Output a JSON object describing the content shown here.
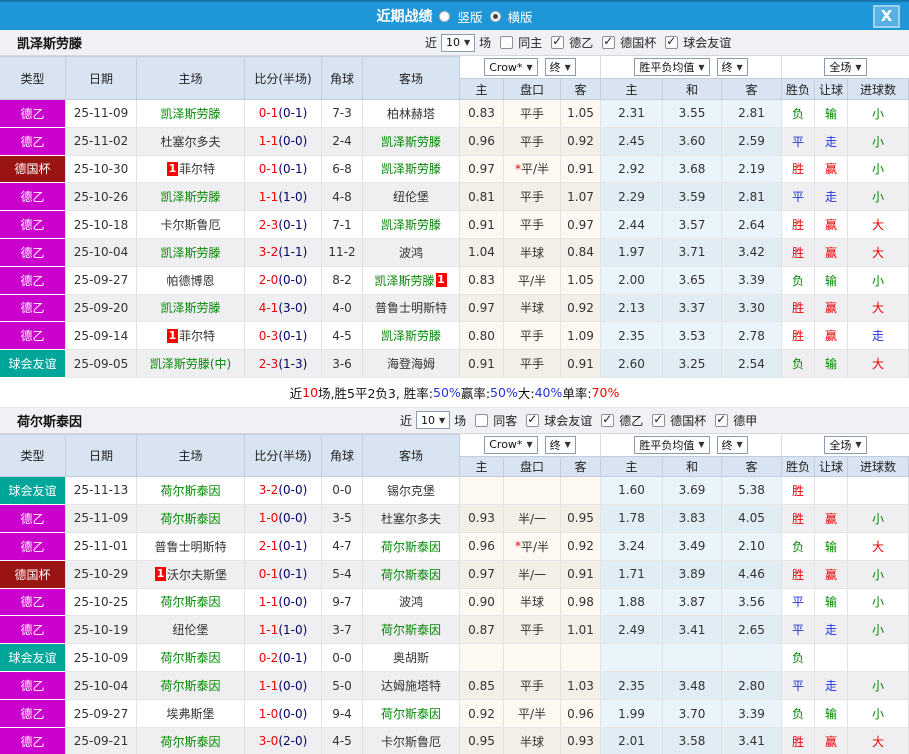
{
  "titlebar": {
    "title": "近期战绩",
    "vertical_label": "竖版",
    "horizontal_label": "横版",
    "close_label": "X"
  },
  "colors": {
    "type_badges": {
      "德乙": "#cc00cc",
      "德国杯": "#9a1414",
      "球会友谊": "#00a69a"
    },
    "results": {
      "胜": "#e60000",
      "赢": "#e60000",
      "大": "#e60000",
      "平": "#2233dd",
      "走": "#2233dd",
      "负": "#008800",
      "输": "#008800",
      "小": "#008800"
    },
    "accent_blue": "#1e96d7"
  },
  "columns": {
    "type": "类型",
    "date": "日期",
    "home": "主场",
    "score": "比分(半场)",
    "corner": "角球",
    "away": "客场",
    "crow_select": "Crow*",
    "crow_final": "终",
    "crow_sub": [
      "主",
      "盘口",
      "客"
    ],
    "mean_select": "胜平负均值",
    "mean_final": "终",
    "mean_sub": [
      "主",
      "和",
      "客"
    ],
    "full_select": "全场",
    "full_sub": [
      "胜负",
      "让球",
      "进球数"
    ]
  },
  "team1": {
    "name": "凯泽斯劳滕",
    "filter": {
      "prefix": "近",
      "count": "10",
      "suffix": "场",
      "same_label": "同主",
      "leagues": [
        {
          "label": "德乙"
        },
        {
          "label": "德国杯"
        },
        {
          "label": "球会友谊"
        }
      ]
    },
    "rows": [
      {
        "type": "德乙",
        "date": "25-11-09",
        "home": {
          "n": "凯泽斯劳滕",
          "g": true
        },
        "ft": "0-1",
        "ht": "(0-1)",
        "corner": "7-3",
        "away": {
          "n": "柏林赫塔"
        },
        "crow": [
          "0.83",
          "平手",
          "1.05"
        ],
        "mean": [
          "2.31",
          "3.55",
          "2.81"
        ],
        "res": [
          "负",
          "输",
          "小"
        ]
      },
      {
        "type": "德乙",
        "date": "25-11-02",
        "home": {
          "n": "杜塞尔多夫"
        },
        "ft": "1-1",
        "ht": "(0-0)",
        "corner": "2-4",
        "away": {
          "n": "凯泽斯劳滕",
          "g": true
        },
        "crow": [
          "0.96",
          "平手",
          "0.92"
        ],
        "mean": [
          "2.45",
          "3.60",
          "2.59"
        ],
        "res": [
          "平",
          "走",
          "小"
        ]
      },
      {
        "type": "德国杯",
        "date": "25-10-30",
        "home": {
          "n": "菲尔特",
          "b": "1"
        },
        "ft": "0-1",
        "ht": "(0-1)",
        "corner": "6-8",
        "away": {
          "n": "凯泽斯劳滕",
          "g": true
        },
        "crow": [
          "0.97",
          "*平/半",
          "0.91"
        ],
        "mean": [
          "2.92",
          "3.68",
          "2.19"
        ],
        "res": [
          "胜",
          "赢",
          "小"
        ]
      },
      {
        "type": "德乙",
        "date": "25-10-26",
        "home": {
          "n": "凯泽斯劳滕",
          "g": true
        },
        "ft": "1-1",
        "ht": "(1-0)",
        "corner": "4-8",
        "away": {
          "n": "纽伦堡"
        },
        "crow": [
          "0.81",
          "平手",
          "1.07"
        ],
        "mean": [
          "2.29",
          "3.59",
          "2.81"
        ],
        "res": [
          "平",
          "走",
          "小"
        ]
      },
      {
        "type": "德乙",
        "date": "25-10-18",
        "home": {
          "n": "卡尔斯鲁厄"
        },
        "ft": "2-3",
        "ht": "(0-1)",
        "corner": "7-1",
        "away": {
          "n": "凯泽斯劳滕",
          "g": true
        },
        "crow": [
          "0.91",
          "平手",
          "0.97"
        ],
        "mean": [
          "2.44",
          "3.57",
          "2.64"
        ],
        "res": [
          "胜",
          "赢",
          "大"
        ]
      },
      {
        "type": "德乙",
        "date": "25-10-04",
        "home": {
          "n": "凯泽斯劳滕",
          "g": true
        },
        "ft": "3-2",
        "ht": "(1-1)",
        "corner": "11-2",
        "away": {
          "n": "波鸿"
        },
        "crow": [
          "1.04",
          "半球",
          "0.84"
        ],
        "mean": [
          "1.97",
          "3.71",
          "3.42"
        ],
        "res": [
          "胜",
          "赢",
          "大"
        ]
      },
      {
        "type": "德乙",
        "date": "25-09-27",
        "home": {
          "n": "帕德博恩"
        },
        "ft": "2-0",
        "ht": "(0-0)",
        "corner": "8-2",
        "away": {
          "n": "凯泽斯劳滕",
          "g": true,
          "b": "1"
        },
        "crow": [
          "0.83",
          "平/半",
          "1.05"
        ],
        "mean": [
          "2.00",
          "3.65",
          "3.39"
        ],
        "res": [
          "负",
          "输",
          "小"
        ]
      },
      {
        "type": "德乙",
        "date": "25-09-20",
        "home": {
          "n": "凯泽斯劳滕",
          "g": true
        },
        "ft": "4-1",
        "ht": "(3-0)",
        "corner": "4-0",
        "away": {
          "n": "普鲁士明斯特"
        },
        "crow": [
          "0.97",
          "半球",
          "0.92"
        ],
        "mean": [
          "2.13",
          "3.37",
          "3.30"
        ],
        "res": [
          "胜",
          "赢",
          "大"
        ]
      },
      {
        "type": "德乙",
        "date": "25-09-14",
        "home": {
          "n": "菲尔特",
          "b": "1"
        },
        "ft": "0-3",
        "ht": "(0-1)",
        "corner": "4-5",
        "away": {
          "n": "凯泽斯劳滕",
          "g": true
        },
        "crow": [
          "0.80",
          "平手",
          "1.09"
        ],
        "mean": [
          "2.35",
          "3.53",
          "2.78"
        ],
        "res": [
          "胜",
          "赢",
          "走"
        ]
      },
      {
        "type": "球会友谊",
        "date": "25-09-05",
        "home": {
          "n": "凯泽斯劳滕(中)",
          "g": true
        },
        "ft": "2-3",
        "ht": "(1-3)",
        "corner": "3-6",
        "away": {
          "n": "海登海姆"
        },
        "crow": [
          "0.91",
          "平手",
          "0.91"
        ],
        "mean": [
          "2.60",
          "3.25",
          "2.54"
        ],
        "res": [
          "负",
          "输",
          "大"
        ]
      }
    ],
    "summary": [
      {
        "t": "近"
      },
      {
        "t": "10",
        "c": "#ee0000"
      },
      {
        "t": "场,胜5平2负3, 胜率:"
      },
      {
        "t": "50%",
        "c": "#2233dd"
      },
      {
        "t": " 赢率:"
      },
      {
        "t": "50%",
        "c": "#2233dd"
      },
      {
        "t": " 大:"
      },
      {
        "t": "40%",
        "c": "#2233dd"
      },
      {
        "t": " 单率:"
      },
      {
        "t": "70%",
        "c": "#ee0000"
      }
    ]
  },
  "team2": {
    "name": "荷尔斯泰因",
    "filter": {
      "prefix": "近",
      "count": "10",
      "suffix": "场",
      "same_label": "同客",
      "leagues": [
        {
          "label": "球会友谊"
        },
        {
          "label": "德乙"
        },
        {
          "label": "德国杯"
        },
        {
          "label": "德甲"
        }
      ]
    },
    "rows": [
      {
        "type": "球会友谊",
        "date": "25-11-13",
        "home": {
          "n": "荷尔斯泰因",
          "g": true
        },
        "ft": "3-2",
        "ht": "(0-0)",
        "corner": "0-0",
        "away": {
          "n": "锡尔克堡"
        },
        "crow": [
          "",
          "",
          ""
        ],
        "mean": [
          "1.60",
          "3.69",
          "5.38"
        ],
        "res": [
          "胜",
          "",
          ""
        ]
      },
      {
        "type": "德乙",
        "date": "25-11-09",
        "home": {
          "n": "荷尔斯泰因",
          "g": true
        },
        "ft": "1-0",
        "ht": "(0-0)",
        "corner": "3-5",
        "away": {
          "n": "杜塞尔多夫"
        },
        "crow": [
          "0.93",
          "半/一",
          "0.95"
        ],
        "mean": [
          "1.78",
          "3.83",
          "4.05"
        ],
        "res": [
          "胜",
          "赢",
          "小"
        ]
      },
      {
        "type": "德乙",
        "date": "25-11-01",
        "home": {
          "n": "普鲁士明斯特"
        },
        "ft": "2-1",
        "ht": "(0-1)",
        "corner": "4-7",
        "away": {
          "n": "荷尔斯泰因",
          "g": true
        },
        "crow": [
          "0.96",
          "*平/半",
          "0.92"
        ],
        "mean": [
          "3.24",
          "3.49",
          "2.10"
        ],
        "res": [
          "负",
          "输",
          "大"
        ]
      },
      {
        "type": "德国杯",
        "date": "25-10-29",
        "home": {
          "n": "沃尔夫斯堡",
          "b": "1"
        },
        "ft": "0-1",
        "ht": "(0-1)",
        "corner": "5-4",
        "away": {
          "n": "荷尔斯泰因",
          "g": true
        },
        "crow": [
          "0.97",
          "半/一",
          "0.91"
        ],
        "mean": [
          "1.71",
          "3.89",
          "4.46"
        ],
        "res": [
          "胜",
          "赢",
          "小"
        ]
      },
      {
        "type": "德乙",
        "date": "25-10-25",
        "home": {
          "n": "荷尔斯泰因",
          "g": true
        },
        "ft": "1-1",
        "ht": "(0-0)",
        "corner": "9-7",
        "away": {
          "n": "波鸿"
        },
        "crow": [
          "0.90",
          "半球",
          "0.98"
        ],
        "mean": [
          "1.88",
          "3.87",
          "3.56"
        ],
        "res": [
          "平",
          "输",
          "小"
        ]
      },
      {
        "type": "德乙",
        "date": "25-10-19",
        "home": {
          "n": "纽伦堡"
        },
        "ft": "1-1",
        "ht": "(1-0)",
        "corner": "3-7",
        "away": {
          "n": "荷尔斯泰因",
          "g": true
        },
        "crow": [
          "0.87",
          "平手",
          "1.01"
        ],
        "mean": [
          "2.49",
          "3.41",
          "2.65"
        ],
        "res": [
          "平",
          "走",
          "小"
        ]
      },
      {
        "type": "球会友谊",
        "date": "25-10-09",
        "home": {
          "n": "荷尔斯泰因",
          "g": true
        },
        "ft": "0-2",
        "ht": "(0-1)",
        "corner": "0-0",
        "away": {
          "n": "奥胡斯"
        },
        "crow": [
          "",
          "",
          ""
        ],
        "mean": [
          "",
          "",
          ""
        ],
        "res": [
          "负",
          "",
          ""
        ]
      },
      {
        "type": "德乙",
        "date": "25-10-04",
        "home": {
          "n": "荷尔斯泰因",
          "g": true
        },
        "ft": "1-1",
        "ht": "(0-0)",
        "corner": "5-0",
        "away": {
          "n": "达姆施塔特"
        },
        "crow": [
          "0.85",
          "平手",
          "1.03"
        ],
        "mean": [
          "2.35",
          "3.48",
          "2.80"
        ],
        "res": [
          "平",
          "走",
          "小"
        ]
      },
      {
        "type": "德乙",
        "date": "25-09-27",
        "home": {
          "n": "埃弗斯堡"
        },
        "ft": "1-0",
        "ht": "(0-0)",
        "corner": "9-4",
        "away": {
          "n": "荷尔斯泰因",
          "g": true
        },
        "crow": [
          "0.92",
          "平/半",
          "0.96"
        ],
        "mean": [
          "1.99",
          "3.70",
          "3.39"
        ],
        "res": [
          "负",
          "输",
          "小"
        ]
      },
      {
        "type": "德乙",
        "date": "25-09-21",
        "home": {
          "n": "荷尔斯泰因",
          "g": true
        },
        "ft": "3-0",
        "ht": "(2-0)",
        "corner": "4-5",
        "away": {
          "n": "卡尔斯鲁厄"
        },
        "crow": [
          "0.95",
          "半球",
          "0.93"
        ],
        "mean": [
          "2.01",
          "3.58",
          "3.41"
        ],
        "res": [
          "胜",
          "赢",
          "大"
        ]
      }
    ]
  }
}
